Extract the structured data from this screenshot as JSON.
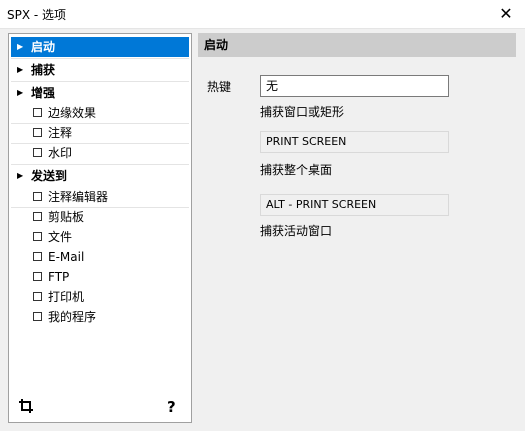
{
  "window": {
    "title": "SPX - 选项",
    "close_glyph": "✕"
  },
  "sidebar": {
    "items": [
      {
        "label": "启动",
        "type": "header",
        "selected": true
      },
      {
        "label": "捕获",
        "type": "header"
      },
      {
        "label": "增强",
        "type": "header"
      },
      {
        "label": "边缘效果",
        "type": "sub"
      },
      {
        "label": "注释",
        "type": "sub"
      },
      {
        "label": "水印",
        "type": "sub"
      },
      {
        "label": "发送到",
        "type": "header"
      },
      {
        "label": "注释编辑器",
        "type": "sub"
      },
      {
        "label": "剪贴板",
        "type": "sub"
      },
      {
        "label": "文件",
        "type": "sub"
      },
      {
        "label": "E-Mail",
        "type": "sub"
      },
      {
        "label": "FTP",
        "type": "sub"
      },
      {
        "label": "打印机",
        "type": "sub"
      },
      {
        "label": "我的程序",
        "type": "sub"
      }
    ],
    "footer": {
      "crop_icon": "⌗",
      "help": "?"
    }
  },
  "panel": {
    "header": "启动",
    "hotkey_label": "热键",
    "hotkeys": [
      {
        "value": "无",
        "description": "捕获窗口或矩形"
      },
      {
        "value": "PRINT SCREEN",
        "description": "捕获整个桌面"
      },
      {
        "value": "ALT - PRINT SCREEN",
        "description": "捕获活动窗口"
      }
    ]
  }
}
